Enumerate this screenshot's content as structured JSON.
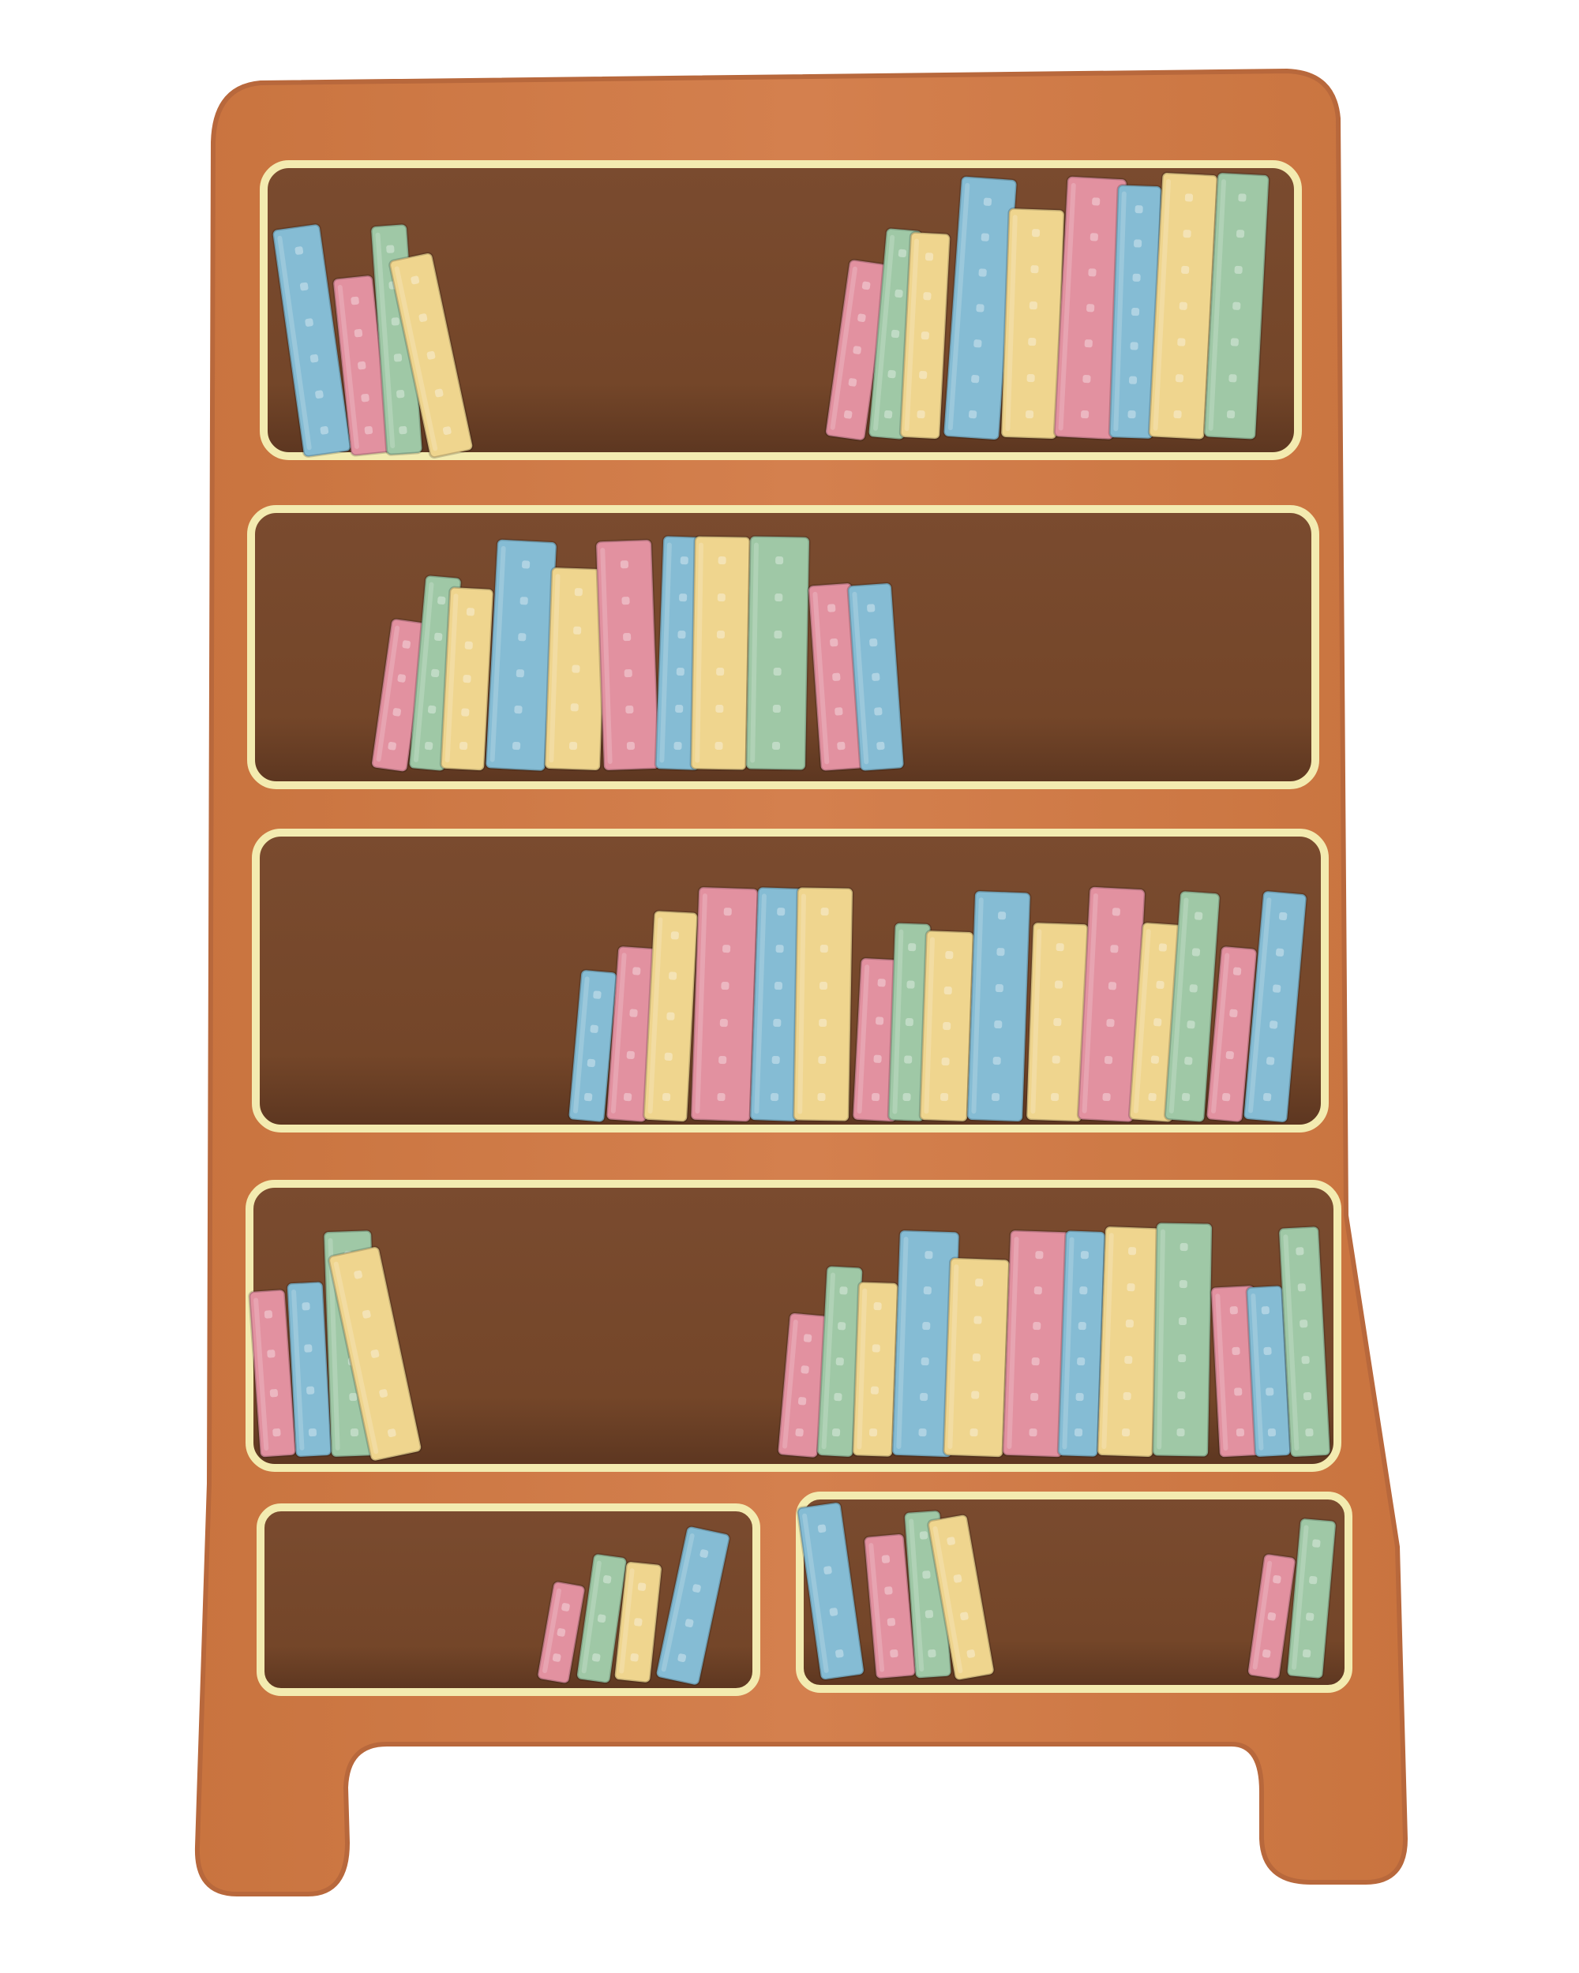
{
  "colors": {
    "background": "#ffffff",
    "frame": "#D4804E",
    "frame_edge": "#B8683C",
    "frame_highlight": "#E39464",
    "shelf_interior": "#774A2F",
    "shelf_shadow": "#5E3822",
    "shelf_trim": "#F3EBB0",
    "book_blue": "#85BCD4",
    "book_pink": "#E291A0",
    "book_green": "#9FC8A6",
    "book_yellow": "#EFD58E"
  },
  "object": "bookshelf-with-books",
  "compartments": [
    {
      "name": "shelf-1",
      "books": [
        "blue",
        "pink",
        "green",
        "yellow",
        "pink",
        "green",
        "yellow",
        "blue",
        "yellow",
        "pink",
        "blue",
        "yellow",
        "green"
      ]
    },
    {
      "name": "shelf-2",
      "books": [
        "pink",
        "green",
        "yellow",
        "blue",
        "yellow",
        "pink",
        "blue",
        "yellow",
        "green",
        "pink",
        "blue"
      ]
    },
    {
      "name": "shelf-3",
      "books": [
        "blue",
        "pink",
        "yellow",
        "pink",
        "blue",
        "yellow",
        "pink",
        "green",
        "yellow",
        "blue",
        "yellow",
        "pink",
        "yellow",
        "green",
        "pink",
        "blue"
      ]
    },
    {
      "name": "shelf-4",
      "books": [
        "pink",
        "blue",
        "green",
        "yellow",
        "pink",
        "green",
        "yellow",
        "blue",
        "yellow",
        "pink",
        "blue",
        "yellow",
        "green",
        "pink",
        "blue",
        "green"
      ]
    },
    {
      "name": "lower-left-cubby",
      "books": [
        "pink",
        "green",
        "yellow",
        "blue"
      ]
    },
    {
      "name": "lower-right-cubby",
      "books": [
        "blue",
        "pink",
        "green",
        "yellow",
        "pink",
        "green"
      ]
    }
  ]
}
